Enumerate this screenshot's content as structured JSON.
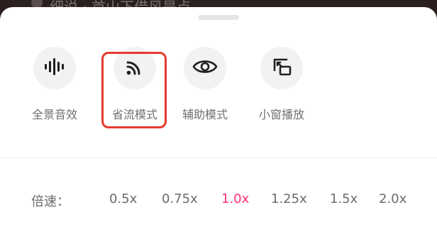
{
  "background": {
    "video_title": "细说 · 首山下借风是点"
  },
  "panel": {
    "features": [
      {
        "label": "全景音效",
        "icon": "audio-waveform-icon"
      },
      {
        "label": "省流模式",
        "icon": "data-saver-icon",
        "highlighted": true
      },
      {
        "label": "辅助模式",
        "icon": "eye-icon"
      },
      {
        "label": "小窗播放",
        "icon": "picture-in-picture-icon"
      }
    ],
    "speed": {
      "label": "倍速：",
      "options": [
        "0.5x",
        "0.75x",
        "1.0x",
        "1.25x",
        "1.5x",
        "2.0x"
      ],
      "selected": "1.0x"
    }
  },
  "colors": {
    "highlight_box": "#e53a2f",
    "active_speed": "#ff2f6e",
    "icon_color": "#1f1f1f",
    "text_muted": "#6b6b6b"
  }
}
